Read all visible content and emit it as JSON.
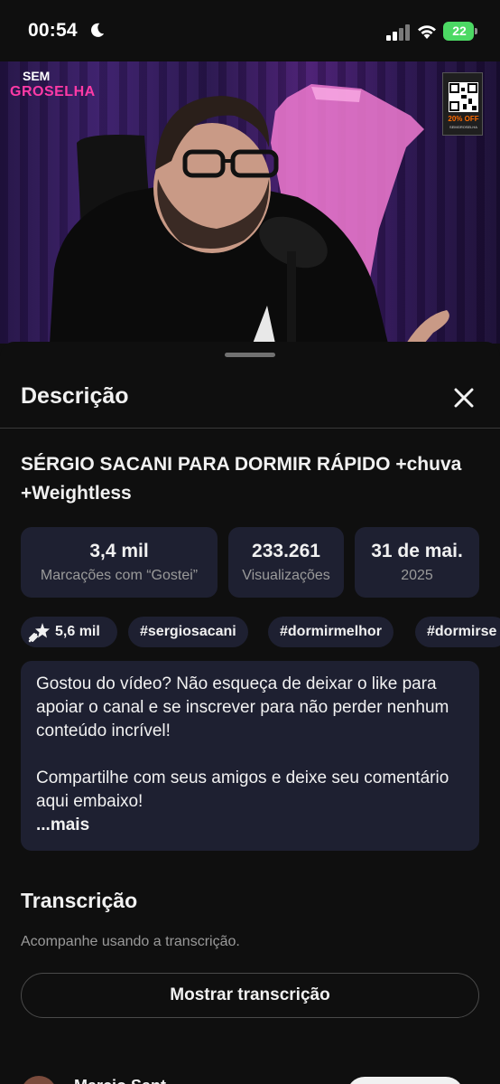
{
  "status_bar": {
    "time": "00:54",
    "battery": "22"
  },
  "video": {
    "logo_top": "SEM",
    "logo_bottom": "GROSELHA",
    "promo_off": "20% OFF",
    "promo_code": "SEMGROSELHA"
  },
  "sheet": {
    "title": "Descrição"
  },
  "video_title": "SÉRGIO SACANI PARA DORMIR RÁPIDO +chuva +Weightless",
  "stats": {
    "likes_value": "3,4 mil",
    "likes_label": "Marcações com “Gostei”",
    "views_value": "233.261",
    "views_label": "Visualizações",
    "date_value": "31 de mai.",
    "date_year": "2025"
  },
  "chips": {
    "thanks_count": "5,6 mil",
    "tags": [
      "#sergiosacani",
      "#dormirmelhor",
      "#dormirse"
    ]
  },
  "description": {
    "paragraph_1": "Gostou do vídeo? Não esqueça de deixar o like para apoiar o canal e se inscrever para não perder nenhum conteúdo incrível!",
    "paragraph_2": "Compartilhe com seus amigos e deixe seu comentário aqui embaixo!",
    "more": "...mais"
  },
  "transcript": {
    "title": "Transcrição",
    "subtitle": "Acompanhe usando a transcrição.",
    "button": "Mostrar transcrição"
  },
  "peek": {
    "name": "Marcio Sant"
  },
  "icons": {
    "close": "close-icon",
    "star": "sparkle-icon",
    "moon": "moon-icon",
    "signal": "signal-icon",
    "wifi": "wifi-icon"
  },
  "colors": {
    "background": "#0f0f0f",
    "card": "#1e2031",
    "secondary_text": "#9a9a9a",
    "brand_pink": "#ff3aa6"
  }
}
